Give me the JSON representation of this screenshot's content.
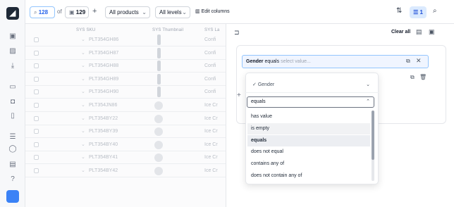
{
  "toolbar": {
    "current_count": "128",
    "of_label": "of",
    "total_count": "129",
    "add_symbol": "+",
    "products_dropdown": "All products",
    "levels_dropdown": "All levels",
    "edit_columns": "Edit columns",
    "filter_count": "1"
  },
  "grid": {
    "columns": [
      "SYS SKU",
      "SYS Thumbnail",
      "SYS La"
    ],
    "rows": [
      {
        "sku": "PLT354GH86",
        "text": "Confi",
        "thumb": "tall"
      },
      {
        "sku": "PLT354GH87",
        "text": "Confi",
        "thumb": "tall"
      },
      {
        "sku": "PLT354GH88",
        "text": "Confi",
        "thumb": "tall"
      },
      {
        "sku": "PLT354GH89",
        "text": "Confi",
        "thumb": "tall"
      },
      {
        "sku": "PLT354GH90",
        "text": "Confi",
        "thumb": "tall"
      },
      {
        "sku": "PLT354JN86",
        "text": "Ice Cr",
        "thumb": "round"
      },
      {
        "sku": "PLT354BY22",
        "text": "Ice Cr",
        "thumb": "round"
      },
      {
        "sku": "PLT354BY39",
        "text": "Ice Cr",
        "thumb": "round"
      },
      {
        "sku": "PLT354BY40",
        "text": "Ice Cr",
        "thumb": "round"
      },
      {
        "sku": "PLT354BY41",
        "text": "Ice Cr",
        "thumb": "round"
      },
      {
        "sku": "PLT354BY42",
        "text": "Ice Cr",
        "thumb": "round"
      }
    ]
  },
  "panel": {
    "clear_all": "Clear all",
    "filter_field": "Gender",
    "filter_operator": "equals",
    "filter_placeholder": "select value..."
  },
  "dropdown": {
    "field_label": "Gender",
    "search_value": "equals",
    "options": [
      {
        "label": "has value",
        "state": "normal"
      },
      {
        "label": "is empty",
        "state": "highlighted"
      },
      {
        "label": "equals",
        "state": "selected"
      },
      {
        "label": "does not equal",
        "state": "normal"
      },
      {
        "label": "contains any of",
        "state": "normal"
      },
      {
        "label": "does not contain any of",
        "state": "normal"
      }
    ]
  },
  "icons": {
    "logo": "app-logo-icon",
    "accent": "#2563eb"
  }
}
